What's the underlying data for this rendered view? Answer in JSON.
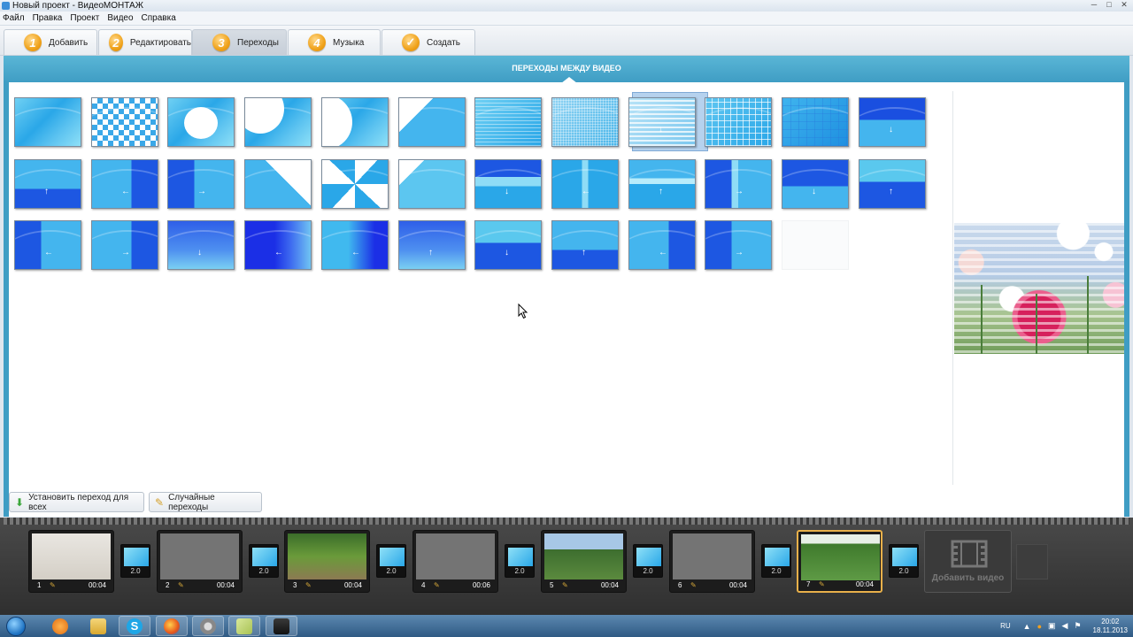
{
  "window": {
    "title": "Новый проект - ВидеоМОНТАЖ",
    "controls": [
      "─",
      "□",
      "✕"
    ]
  },
  "menu": [
    "Файл",
    "Правка",
    "Проект",
    "Видео",
    "Справка"
  ],
  "tabs": [
    {
      "num": "1",
      "label": "Добавить"
    },
    {
      "num": "2",
      "label": "Редактировать"
    },
    {
      "num": "3",
      "label": "Переходы"
    },
    {
      "num": "4",
      "label": "Музыка"
    },
    {
      "num": "✓",
      "label": "Создать"
    }
  ],
  "active_tab": "Переходы",
  "header": {
    "title": "ПЕРЕХОДЫ МЕЖДУ ВИДЕО"
  },
  "transitions": {
    "rows": 3,
    "selected_index": 8,
    "items": [
      "dissolve",
      "checker",
      "circle-expand",
      "circle-corner",
      "circle-left",
      "diagonal-wipe",
      "horizontal-lines",
      "fine-mesh",
      "blinds",
      "grid",
      "grid-large",
      "wipe-down",
      "wipe-up",
      "push-left",
      "push-right",
      "corner-fold",
      "pinwheel",
      "slant",
      "bar-horizontal",
      "bar-vertical",
      "bar-horizontal-2",
      "bar-vertical-2",
      "split-down",
      "split-up",
      "slide-left",
      "slide-right",
      "fade-down",
      "deep-right",
      "deep-left",
      "wave-up",
      "wave-down",
      "drop-up",
      "stripe-left",
      "stripe-right",
      "empty"
    ]
  },
  "buttons": {
    "set_all": "Установить переход для всех",
    "random": "Случайные переходы"
  },
  "timeline": {
    "clips": [
      {
        "n": "1",
        "dur": "00:04"
      },
      {
        "n": "2",
        "dur": "00:04"
      },
      {
        "n": "3",
        "dur": "00:04"
      },
      {
        "n": "4",
        "dur": "00:06"
      },
      {
        "n": "5",
        "dur": "00:04"
      },
      {
        "n": "6",
        "dur": "00:04"
      },
      {
        "n": "7",
        "dur": "00:04"
      }
    ],
    "transition_value": "2.0",
    "active_clip": 7,
    "add_label": "Добавить видео"
  },
  "taskbar": {
    "lang": "RU",
    "time": "20:02",
    "date": "18.11.2013"
  }
}
